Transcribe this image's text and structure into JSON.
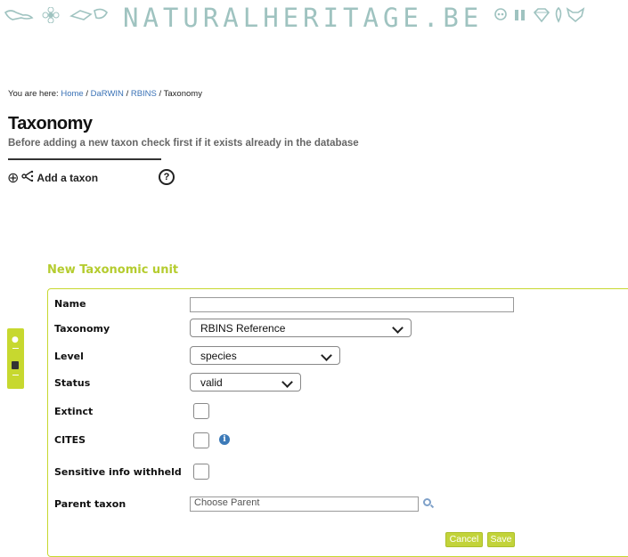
{
  "banner": {
    "brand": "NATURALHERITAGE.BE",
    "left_icons": [
      "bird-icon",
      "flower-icon",
      "bird-icon-2"
    ],
    "right_icons": [
      "skull-icon",
      "fossil-icon",
      "gem-icon",
      "feather-icon",
      "fox-icon"
    ]
  },
  "breadcrumb": {
    "prefix": "You are here:",
    "items": [
      "Home",
      "DaRWIN",
      "RBINS"
    ],
    "current": "Taxonomy",
    "separator": "/"
  },
  "page": {
    "title": "Taxonomy",
    "subtitle": "Before adding a new taxon check first if it exists already in the database",
    "add_taxon_label": "Add a taxon",
    "help_symbol": "?"
  },
  "form": {
    "section_title": "New Taxonomic unit",
    "fields": {
      "name": {
        "label": "Name",
        "value": ""
      },
      "taxonomy": {
        "label": "Taxonomy",
        "value": "RBINS Reference"
      },
      "level": {
        "label": "Level",
        "value": "species"
      },
      "status": {
        "label": "Status",
        "value": "valid"
      },
      "extinct": {
        "label": "Extinct",
        "checked": false
      },
      "cites": {
        "label": "CITES",
        "checked": false,
        "info": "i"
      },
      "sensitive": {
        "label": "Sensitive info withheld",
        "checked": false
      },
      "parent": {
        "label": "Parent taxon",
        "placeholder": "Choose Parent"
      }
    },
    "cancel_label": "Cancel",
    "save_label": "Save"
  },
  "colors": {
    "accent": "#c7d82f",
    "section_title": "#b5cc2f",
    "banner": "#9fc3c0",
    "link": "#3a72b6"
  }
}
